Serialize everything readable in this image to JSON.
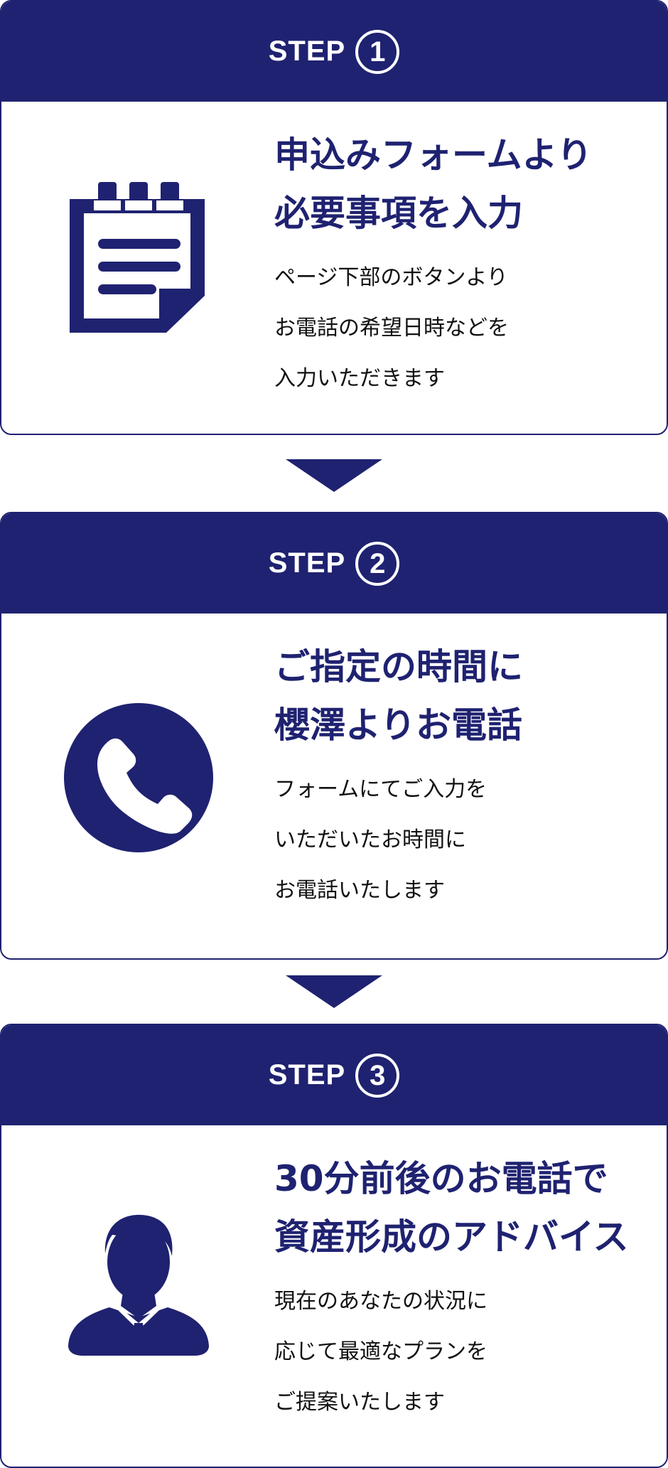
{
  "steps": [
    {
      "label": "STEP",
      "number": "1",
      "icon": "notepad-icon",
      "title_lines": [
        "申込みフォームより",
        "必要事項を入力"
      ],
      "desc_lines": [
        "ページ下部のボタンより",
        "お電話の希望日時などを",
        "入力いただきます"
      ]
    },
    {
      "label": "STEP",
      "number": "2",
      "icon": "phone-icon",
      "title_lines": [
        "ご指定の時間に",
        "櫻澤よりお電話"
      ],
      "desc_lines": [
        "フォームにてご入力を",
        "いただいたお時間に",
        "お電話いたします"
      ]
    },
    {
      "label": "STEP",
      "number": "3",
      "icon": "advisor-person-icon",
      "title_lines": [
        "30分前後のお電話で",
        "資産形成のアドバイス"
      ],
      "desc_lines": [
        "現在のあなたの状況に",
        "応じて最適なプランを",
        "ご提案いたします"
      ]
    }
  ],
  "colors": {
    "brand": "#1f2270",
    "text": "#111111",
    "background": "#ffffff"
  }
}
